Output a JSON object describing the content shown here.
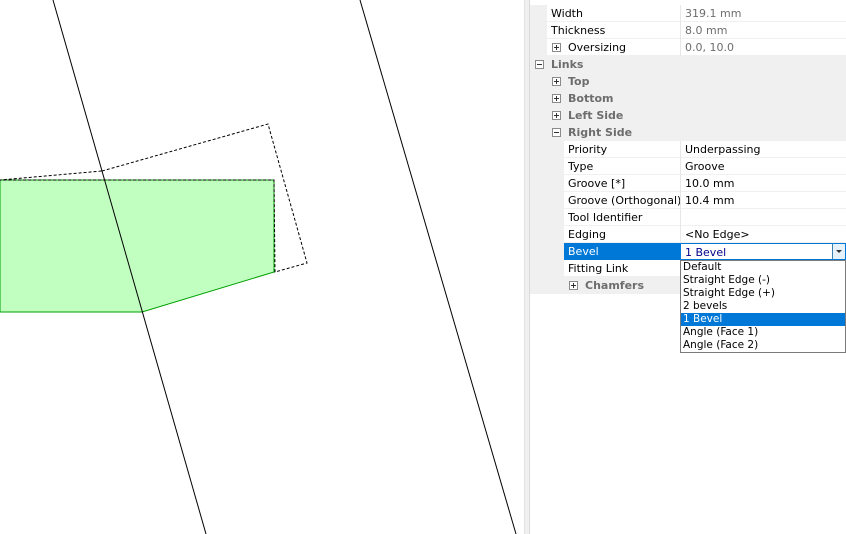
{
  "properties": {
    "width": {
      "label": "Width",
      "value": "319.1 mm"
    },
    "thickness": {
      "label": "Thickness",
      "value": "8.0 mm"
    },
    "oversizing": {
      "label": "Oversizing",
      "value": "0.0, 10.0"
    },
    "links": {
      "label": "Links",
      "top": "Top",
      "bottom": "Bottom",
      "left_side": "Left Side",
      "right_side": {
        "label": "Right Side",
        "priority": {
          "label": "Priority",
          "value": "Underpassing"
        },
        "type": {
          "label": "Type",
          "value": "Groove"
        },
        "groove": {
          "label": "Groove [*]",
          "value": "10.0 mm"
        },
        "groove_orthogonal": {
          "label": "Groove (Orthogonal)",
          "value": "10.4 mm"
        },
        "tool_identifier": {
          "label": "Tool Identifier",
          "value": ""
        },
        "edging": {
          "label": "Edging",
          "value": "<No Edge>"
        },
        "bevel": {
          "label": "Bevel",
          "value": "1 Bevel"
        },
        "fitting_link": {
          "label": "Fitting Link"
        },
        "chamfers": {
          "label": "Chamfers"
        }
      }
    }
  },
  "bevel_dropdown": {
    "options": [
      "Default",
      "Straight Edge (-)",
      "Straight Edge (+)",
      "2 bevels",
      "1 Bevel",
      "Angle (Face 1)",
      "Angle (Face 2)"
    ],
    "selected": "1 Bevel"
  },
  "colors": {
    "selection": "#0078d7",
    "panel_fill": "#c1ffc1",
    "panel_stroke": "#00a000",
    "group_background": "#f0f0f0"
  }
}
